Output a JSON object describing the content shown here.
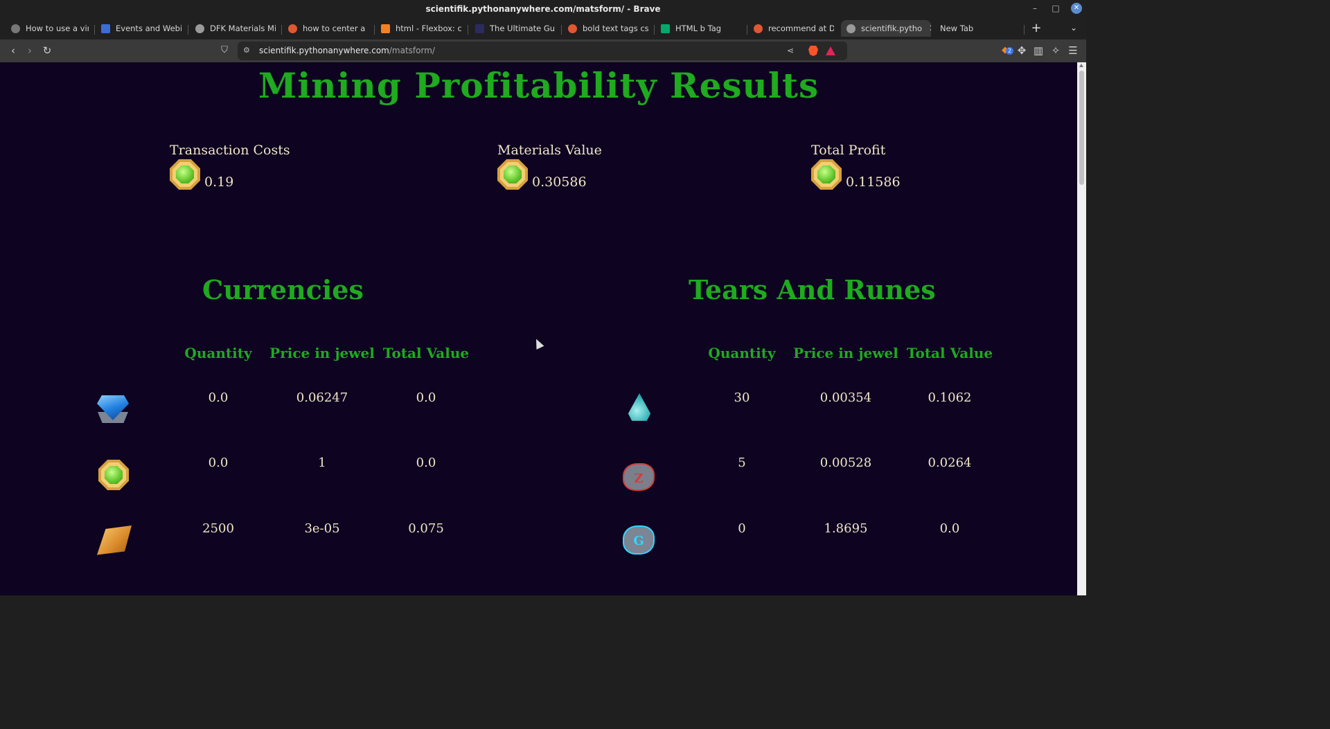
{
  "window": {
    "title": "scientifik.pythonanywhere.com/matsform/ - Brave"
  },
  "tabs": [
    {
      "label": "How to use a virtua",
      "favicon_color": "#777777"
    },
    {
      "label": "Events and Webinar",
      "favicon_color": "#3b6dd6"
    },
    {
      "label": "DFK Materials Minin",
      "favicon_color": "#9a9a9a"
    },
    {
      "label": "how to center a fle",
      "favicon_color": "#de5833"
    },
    {
      "label": "html - Flexbox: cent",
      "favicon_color": "#f48024"
    },
    {
      "label": "The Ultimate Guide",
      "favicon_color": "#2b2b5f"
    },
    {
      "label": "bold text tags css a",
      "favicon_color": "#de5833"
    },
    {
      "label": "HTML b Tag",
      "favicon_color": "#04aa6d"
    },
    {
      "label": "recommend at Duc",
      "favicon_color": "#de5833"
    },
    {
      "label": "scientifik.pytho",
      "favicon_color": "#9a9a9a"
    },
    {
      "label": "New Tab",
      "favicon_color": ""
    }
  ],
  "toolbar": {
    "url_host": "scientifik.pythonanywhere.com",
    "url_path": "/matsform/",
    "extension_badge": "2"
  },
  "page": {
    "title": "Mining Profitability Results",
    "stats": {
      "transaction_costs": {
        "label": "Transaction Costs",
        "value": "0.19"
      },
      "materials_value": {
        "label": "Materials Value",
        "value": "0.30586"
      },
      "total_profit": {
        "label": "Total Profit",
        "value": "0.11586"
      }
    },
    "currencies": {
      "title": "Currencies",
      "headers": [
        "Quantity",
        "Price in jewel",
        "Total Value"
      ],
      "rows": [
        {
          "icon": "blue-crystal-icon",
          "quantity": "0.0",
          "price": "0.06247",
          "total": "0.0"
        },
        {
          "icon": "jewel-coin-icon",
          "quantity": "0.0",
          "price": "1",
          "total": "0.0"
        },
        {
          "icon": "gold-bar-icon",
          "quantity": "2500",
          "price": "3e-05",
          "total": "0.075"
        }
      ]
    },
    "tears_runes": {
      "title": "Tears And Runes",
      "headers": [
        "Quantity",
        "Price in jewel",
        "Total Value"
      ],
      "rows": [
        {
          "icon": "gaia-tear-icon",
          "quantity": "30",
          "price": "0.00354",
          "total": "0.1062"
        },
        {
          "icon": "red-rune-icon",
          "quantity": "5",
          "price": "0.00528",
          "total": "0.0264"
        },
        {
          "icon": "cyan-rune-icon",
          "quantity": "0",
          "price": "1.8695",
          "total": "0.0"
        }
      ]
    }
  },
  "colors": {
    "page_bg": "#0e0421",
    "heading_green": "#1faa1f",
    "text_cream": "#f0e6c8"
  }
}
